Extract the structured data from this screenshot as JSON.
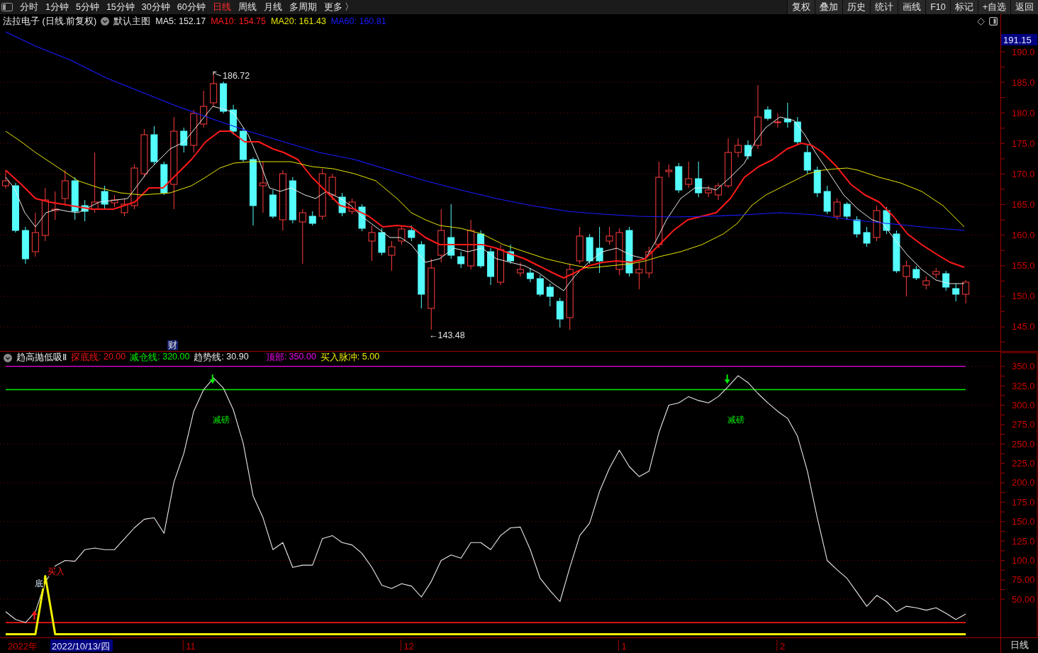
{
  "toolbar": {
    "periods": [
      {
        "label": "分时",
        "selected": false
      },
      {
        "label": "1分钟",
        "selected": false
      },
      {
        "label": "5分钟",
        "selected": false
      },
      {
        "label": "15分钟",
        "selected": false
      },
      {
        "label": "30分钟",
        "selected": false
      },
      {
        "label": "60分钟",
        "selected": false
      },
      {
        "label": "日线",
        "selected": true
      },
      {
        "label": "周线",
        "selected": false
      },
      {
        "label": "月线",
        "selected": false
      },
      {
        "label": "多周期",
        "selected": false
      },
      {
        "label": "更多 〉",
        "selected": false
      }
    ],
    "buttons": [
      "复权",
      "叠加",
      "历史",
      "统计",
      "画线",
      "F10",
      "标记",
      "+自选",
      "返回"
    ]
  },
  "main_chart": {
    "title": "法拉电子 (日线.前复权)",
    "template": "默认主图",
    "indicators": [
      {
        "text": "MA5: 152.17",
        "color": "#e8e8e8"
      },
      {
        "text": "MA10: 154.75",
        "color": "#ff1a1a"
      },
      {
        "text": "MA20: 161.43",
        "color": "#e6e600"
      },
      {
        "text": "MA60: 160.81",
        "color": "#1a1aff"
      }
    ],
    "price_labels": [
      "190.0",
      "185.0",
      "180.0",
      "175.0",
      "170.0",
      "165.0",
      "160.0",
      "155.0",
      "150.0",
      "145.0"
    ],
    "last_price": "191.15",
    "high_label": "186.72",
    "low_label": "←143.48",
    "marker": "财"
  },
  "indicator_panel": {
    "title": "趋高抛低吸Ⅱ",
    "legend_values": [
      ": 20.00",
      ": 320.00",
      ": 30.90",
      ": 350.00",
      ": 5.00"
    ],
    "date_labels": [
      "2022年",
      "11",
      "12",
      "1",
      "2"
    ],
    "cursor_date": "2022/10/13/四",
    "chart_data": {
      "type": "line",
      "grid": true,
      "ylim": [
        0,
        368
      ],
      "yticks": [
        {
          "value": 350,
          "label": "350.0"
        },
        {
          "value": 325,
          "label": "325.0"
        },
        {
          "value": 300,
          "label": "300.0"
        },
        {
          "value": 275,
          "label": "275.0"
        },
        {
          "value": 250,
          "label": "250.0"
        },
        {
          "value": 225,
          "label": "225.0"
        },
        {
          "value": 200,
          "label": "200.0"
        },
        {
          "value": 175,
          "label": "175.0"
        },
        {
          "value": 150,
          "label": "150.0"
        },
        {
          "value": 125,
          "label": "125.0"
        },
        {
          "value": 100,
          "label": "100.0"
        },
        {
          "value": 75,
          "label": "75.00"
        },
        {
          "value": 50,
          "label": "50.00"
        }
      ],
      "series": [
        {
          "name": "探底线",
          "color": "#f01414",
          "values": [
            20,
            20,
            20,
            20,
            20,
            20,
            20,
            20,
            20,
            20,
            20,
            20,
            20,
            20,
            20,
            20,
            20,
            20,
            20,
            20,
            20,
            20,
            20,
            20,
            20,
            20,
            20,
            20,
            20,
            20,
            20,
            20,
            20,
            20,
            20,
            20,
            20,
            20,
            20,
            20,
            20,
            20,
            20,
            20,
            20,
            20,
            20,
            20,
            20,
            20,
            20,
            20,
            20,
            20,
            20,
            20,
            20,
            20,
            20,
            20,
            20,
            20,
            20,
            20,
            20,
            20,
            20,
            20,
            20,
            20,
            20,
            20,
            20,
            20,
            20,
            20,
            20,
            20,
            20,
            20,
            20,
            20,
            20,
            20,
            20,
            20,
            20,
            20,
            20,
            20,
            20,
            20,
            20,
            20,
            20,
            20,
            20,
            20
          ]
        },
        {
          "name": "减仓线",
          "color": "#00ee00",
          "values": [
            320,
            320,
            320,
            320,
            320,
            320,
            320,
            320,
            320,
            320,
            320,
            320,
            320,
            320,
            320,
            320,
            320,
            320,
            320,
            320,
            320,
            320,
            320,
            320,
            320,
            320,
            320,
            320,
            320,
            320,
            320,
            320,
            320,
            320,
            320,
            320,
            320,
            320,
            320,
            320,
            320,
            320,
            320,
            320,
            320,
            320,
            320,
            320,
            320,
            320,
            320,
            320,
            320,
            320,
            320,
            320,
            320,
            320,
            320,
            320,
            320,
            320,
            320,
            320,
            320,
            320,
            320,
            320,
            320,
            320,
            320,
            320,
            320,
            320,
            320,
            320,
            320,
            320,
            320,
            320,
            320,
            320,
            320,
            320,
            320,
            320,
            320,
            320,
            320,
            320,
            320,
            320,
            320,
            320,
            320,
            320,
            320,
            320
          ]
        },
        {
          "name": "趋势线",
          "color": "#e8e8e8",
          "values": [
            34,
            24,
            20,
            34,
            72,
            93,
            100,
            99,
            114,
            116,
            114,
            114,
            128,
            142,
            153,
            155,
            135,
            201,
            238,
            292,
            320,
            335,
            322,
            294,
            251,
            183,
            155,
            114,
            123,
            91,
            94,
            94,
            128,
            132,
            123,
            120,
            109,
            91,
            68,
            64,
            70,
            67,
            53,
            73,
            100,
            107,
            103,
            123,
            123,
            114,
            132,
            142,
            143,
            114,
            77,
            61,
            47,
            91,
            132,
            148,
            189,
            219,
            242,
            221,
            208,
            215,
            265,
            300,
            303,
            311,
            306,
            303,
            311,
            324,
            338,
            329,
            315,
            303,
            292,
            283,
            260,
            215,
            155,
            100,
            88,
            77,
            59,
            41,
            55,
            47,
            34,
            41,
            39,
            36,
            39,
            32,
            24,
            31
          ]
        },
        {
          "name": "顶部",
          "color": "#ee00ee",
          "values": [
            350,
            350,
            350,
            350,
            350,
            350,
            350,
            350,
            350,
            350,
            350,
            350,
            350,
            350,
            350,
            350,
            350,
            350,
            350,
            350,
            350,
            350,
            350,
            350,
            350,
            350,
            350,
            350,
            350,
            350,
            350,
            350,
            350,
            350,
            350,
            350,
            350,
            350,
            350,
            350,
            350,
            350,
            350,
            350,
            350,
            350,
            350,
            350,
            350,
            350,
            350,
            350,
            350,
            350,
            350,
            350,
            350,
            350,
            350,
            350,
            350,
            350,
            350,
            350,
            350,
            350,
            350,
            350,
            350,
            350,
            350,
            350,
            350,
            350,
            350,
            350,
            350,
            350,
            350,
            350,
            350,
            350,
            350,
            350,
            350,
            350,
            350,
            350,
            350,
            350,
            350,
            350,
            350,
            350,
            350,
            350,
            350,
            350
          ]
        },
        {
          "name": "买入脉冲",
          "color": "#f0f000",
          "values": [
            5,
            5,
            5,
            5,
            80,
            5,
            5,
            5,
            5,
            5,
            5,
            5,
            5,
            5,
            5,
            5,
            5,
            5,
            5,
            5,
            5,
            5,
            5,
            5,
            5,
            5,
            5,
            5,
            5,
            5,
            5,
            5,
            5,
            5,
            5,
            5,
            5,
            5,
            5,
            5,
            5,
            5,
            5,
            5,
            5,
            5,
            5,
            5,
            5,
            5,
            5,
            5,
            5,
            5,
            5,
            5,
            5,
            5,
            5,
            5,
            5,
            5,
            5,
            5,
            5,
            5,
            5,
            5,
            5,
            5,
            5,
            5,
            5,
            5,
            5,
            5,
            5,
            5,
            5,
            5,
            5,
            5,
            5,
            5,
            5,
            5,
            5,
            5,
            5,
            5,
            5,
            5,
            5,
            5,
            5,
            5,
            5,
            5
          ]
        }
      ],
      "annotations": [
        "减磅",
        "减磅",
        "底",
        "买入"
      ]
    }
  },
  "period_label": "日线"
}
